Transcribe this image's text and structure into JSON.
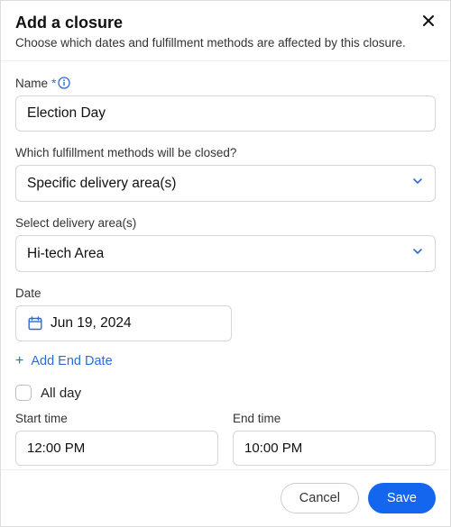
{
  "header": {
    "title": "Add a closure",
    "subtitle": "Choose which dates and fulfillment methods are affected by this closure."
  },
  "name": {
    "label": "Name",
    "value": "Election Day"
  },
  "fulfillment": {
    "label": "Which fulfillment methods will be closed?",
    "selected": "Specific delivery area(s)"
  },
  "delivery_area": {
    "label": "Select delivery area(s)",
    "selected": "Hi-tech Area"
  },
  "date": {
    "label": "Date",
    "value": "Jun 19, 2024"
  },
  "add_end_date_label": "Add End Date",
  "all_day": {
    "label": "All day",
    "checked": false
  },
  "start_time": {
    "label": "Start time",
    "value": "12:00 PM"
  },
  "end_time": {
    "label": "End time",
    "value": "10:00 PM"
  },
  "footer": {
    "cancel": "Cancel",
    "save": "Save"
  }
}
